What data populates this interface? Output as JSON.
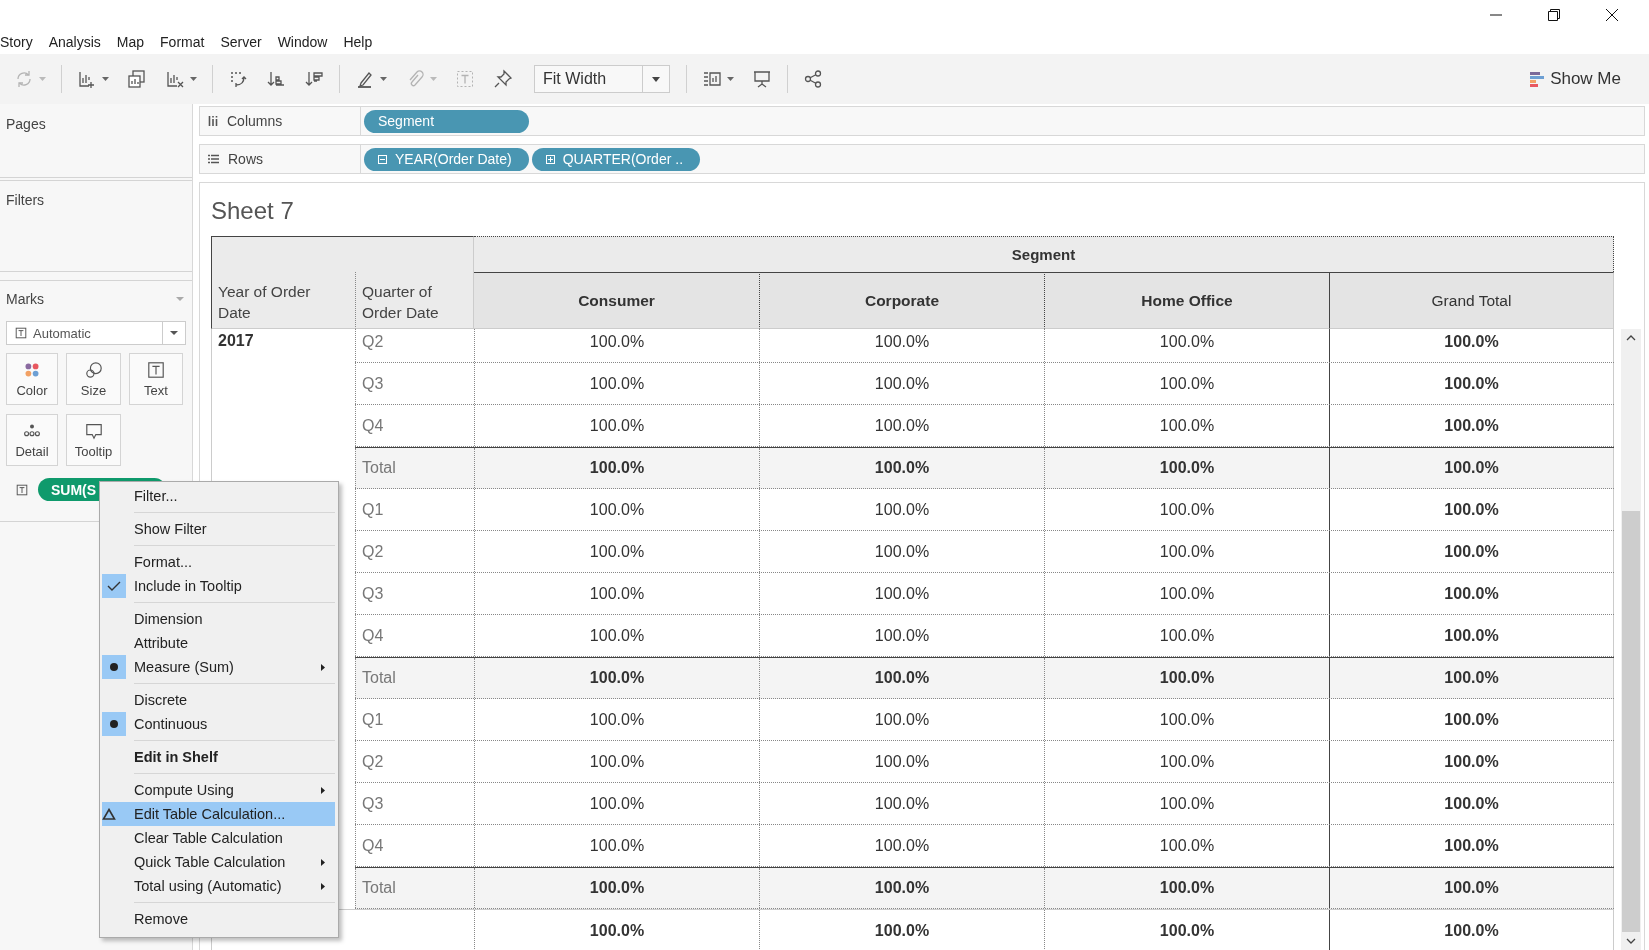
{
  "menu_bar": [
    "Story",
    "Analysis",
    "Map",
    "Format",
    "Server",
    "Window",
    "Help"
  ],
  "toolbar": {
    "buttons": [
      {
        "kind": "refresh",
        "disabled": true,
        "dropdown": true
      },
      {
        "kind": "separator"
      },
      {
        "kind": "new-worksheet",
        "disabled": false,
        "dropdown": true
      },
      {
        "kind": "duplicate",
        "disabled": false,
        "dropdown": false
      },
      {
        "kind": "clear",
        "disabled": false,
        "dropdown": true
      },
      {
        "kind": "separator"
      },
      {
        "kind": "swap",
        "disabled": false,
        "dropdown": false
      },
      {
        "kind": "sort-ascending",
        "disabled": false,
        "dropdown": false
      },
      {
        "kind": "sort-descending",
        "disabled": false,
        "dropdown": false
      },
      {
        "kind": "separator"
      },
      {
        "kind": "highlight",
        "disabled": false,
        "dropdown": true
      },
      {
        "kind": "attach",
        "disabled": true,
        "dropdown": true
      },
      {
        "kind": "labels",
        "disabled": true,
        "dropdown": false
      },
      {
        "kind": "pin",
        "disabled": false,
        "dropdown": false
      },
      {
        "kind": "fit",
        "value": "Fit Width"
      },
      {
        "kind": "separator"
      },
      {
        "kind": "cards",
        "disabled": false,
        "dropdown": true
      },
      {
        "kind": "presentation",
        "disabled": false,
        "dropdown": false
      },
      {
        "kind": "separator"
      },
      {
        "kind": "share",
        "disabled": false,
        "dropdown": false
      }
    ],
    "show_me": "Show Me"
  },
  "side_panel": {
    "pages": "Pages",
    "filters": "Filters",
    "marks": {
      "title": "Marks",
      "mark_type": "Automatic",
      "cards": [
        {
          "kind": "color",
          "label": "Color"
        },
        {
          "kind": "size",
          "label": "Size"
        },
        {
          "kind": "text",
          "label": "Text"
        },
        {
          "kind": "detail",
          "label": "Detail"
        },
        {
          "kind": "tooltip",
          "label": "Tooltip"
        }
      ],
      "pill": "SUM(S"
    }
  },
  "shelves": [
    {
      "kind": "columns",
      "label": "Columns",
      "pills": [
        {
          "label": "Segment"
        }
      ]
    },
    {
      "kind": "rows",
      "label": "Rows",
      "pills": [
        {
          "label": "YEAR(Order Date)",
          "kind": "collapse"
        },
        {
          "label": "QUARTER(Order ..",
          "kind": "expand"
        }
      ]
    }
  ],
  "sheet": {
    "title": "Sheet 7",
    "table": {
      "group_header": "Segment",
      "row_headers": [
        "Year of Order Date",
        "Quarter of Order Date"
      ],
      "columns": [
        {
          "label": "Consumer",
          "kind": "segment"
        },
        {
          "label": "Corporate",
          "kind": "segment"
        },
        {
          "label": "Home Office",
          "kind": "segment"
        },
        {
          "label": "Grand Total",
          "kind": "grand_total"
        }
      ],
      "groups": [
        {
          "year": "2017",
          "rows": [
            {
              "kind": "quarter",
              "label": "Q2",
              "values": [
                "100.0%",
                "100.0%",
                "100.0%",
                "100.0%"
              ]
            },
            {
              "kind": "quarter",
              "label": "Q3",
              "values": [
                "100.0%",
                "100.0%",
                "100.0%",
                "100.0%"
              ]
            },
            {
              "kind": "quarter",
              "label": "Q4",
              "values": [
                "100.0%",
                "100.0%",
                "100.0%",
                "100.0%"
              ]
            },
            {
              "kind": "total",
              "label": "Total",
              "values": [
                "100.0%",
                "100.0%",
                "100.0%",
                "100.0%"
              ]
            }
          ]
        },
        {
          "rows": [
            {
              "kind": "quarter",
              "label": "Q1",
              "values": [
                "100.0%",
                "100.0%",
                "100.0%",
                "100.0%"
              ]
            },
            {
              "kind": "quarter",
              "label": "Q2",
              "values": [
                "100.0%",
                "100.0%",
                "100.0%",
                "100.0%"
              ]
            },
            {
              "kind": "quarter",
              "label": "Q3",
              "values": [
                "100.0%",
                "100.0%",
                "100.0%",
                "100.0%"
              ]
            },
            {
              "kind": "quarter",
              "label": "Q4",
              "values": [
                "100.0%",
                "100.0%",
                "100.0%",
                "100.0%"
              ]
            },
            {
              "kind": "total",
              "label": "Total",
              "values": [
                "100.0%",
                "100.0%",
                "100.0%",
                "100.0%"
              ]
            }
          ]
        },
        {
          "rows": [
            {
              "kind": "quarter",
              "label": "Q1",
              "values": [
                "100.0%",
                "100.0%",
                "100.0%",
                "100.0%"
              ]
            },
            {
              "kind": "quarter",
              "label": "Q2",
              "values": [
                "100.0%",
                "100.0%",
                "100.0%",
                "100.0%"
              ]
            },
            {
              "kind": "quarter",
              "label": "Q3",
              "values": [
                "100.0%",
                "100.0%",
                "100.0%",
                "100.0%"
              ]
            },
            {
              "kind": "quarter",
              "label": "Q4",
              "values": [
                "100.0%",
                "100.0%",
                "100.0%",
                "100.0%"
              ]
            },
            {
              "kind": "total",
              "label": "Total",
              "values": [
                "100.0%",
                "100.0%",
                "100.0%",
                "100.0%"
              ]
            }
          ]
        }
      ],
      "grand_total": {
        "values": [
          "100.0%",
          "100.0%",
          "100.0%",
          "100.0%"
        ]
      }
    }
  },
  "context_menu": {
    "groups": [
      [
        {
          "kind": "command",
          "label": "Filter...",
          "submenu": false,
          "selected": false
        }
      ],
      [
        {
          "kind": "command",
          "label": "Show Filter",
          "submenu": false,
          "selected": false
        }
      ],
      [
        {
          "kind": "command",
          "label": "Format...",
          "submenu": false,
          "selected": false
        },
        {
          "kind": "check",
          "label": "Include in Tooltip",
          "checked": true,
          "submenu": false,
          "selected": false
        }
      ],
      [
        {
          "kind": "radio",
          "label": "Dimension",
          "checked": false,
          "submenu": false,
          "selected": false
        },
        {
          "kind": "radio",
          "label": "Attribute",
          "checked": false,
          "submenu": false,
          "selected": false
        },
        {
          "kind": "radio",
          "label": "Measure (Sum)",
          "checked": true,
          "submenu": true,
          "selected": false
        }
      ],
      [
        {
          "kind": "radio",
          "label": "Discrete",
          "checked": false,
          "submenu": false,
          "selected": false
        },
        {
          "kind": "radio",
          "label": "Continuous",
          "checked": true,
          "submenu": false,
          "selected": false
        }
      ],
      [
        {
          "kind": "default",
          "label": "Edit in Shelf",
          "submenu": false,
          "selected": false
        }
      ],
      [
        {
          "kind": "command",
          "label": "Compute Using",
          "submenu": true,
          "selected": false
        },
        {
          "kind": "table-calc",
          "label": "Edit Table Calculation...",
          "submenu": false,
          "selected": true
        },
        {
          "kind": "command",
          "label": "Clear Table Calculation",
          "submenu": false,
          "selected": false
        },
        {
          "kind": "command",
          "label": "Quick Table Calculation",
          "submenu": true,
          "selected": false
        },
        {
          "kind": "command",
          "label": "Total using (Automatic)",
          "submenu": true,
          "selected": false
        }
      ],
      [
        {
          "kind": "command",
          "label": "Remove",
          "submenu": false,
          "selected": false
        }
      ]
    ]
  }
}
